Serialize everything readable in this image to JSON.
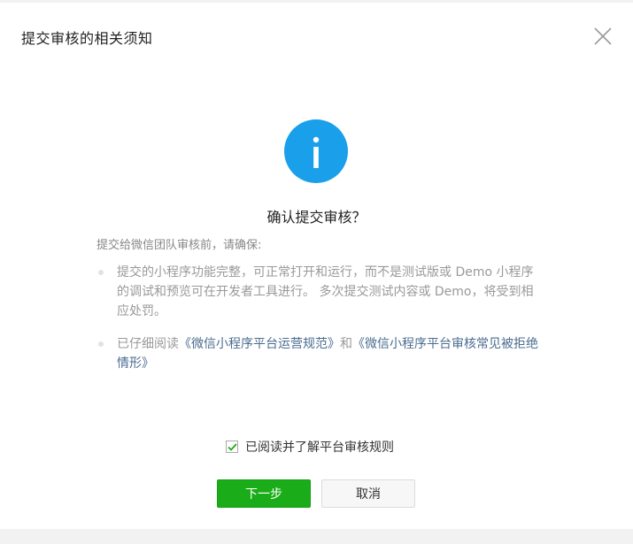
{
  "dialog": {
    "title": "提交审核的相关须知",
    "close_icon": "close-icon",
    "info_icon": "info-icon",
    "heading": "确认提交审核？",
    "intro": "提交给微信团队审核前，请确保:",
    "rules": [
      {
        "text": "提交的小程序功能完整，可正常打开和运行，而不是测试版或 Demo 小程序的调试和预览可在开发者工具进行。 多次提交测试内容或 Demo，将受到相应处罚。"
      },
      {
        "prefix": "已仔细阅读",
        "link1": "《微信小程序平台运营规范》",
        "middle": "和",
        "link2": "《微信小程序平台审核常见被拒绝情形》"
      }
    ],
    "agree_label": "已阅读并了解平台审核规则",
    "agree_checked": true,
    "next_button": "下一步",
    "cancel_button": "取消"
  },
  "colors": {
    "primary": "#1aad19",
    "info_blue": "#1aa0ea",
    "link": "#4a6c90"
  }
}
